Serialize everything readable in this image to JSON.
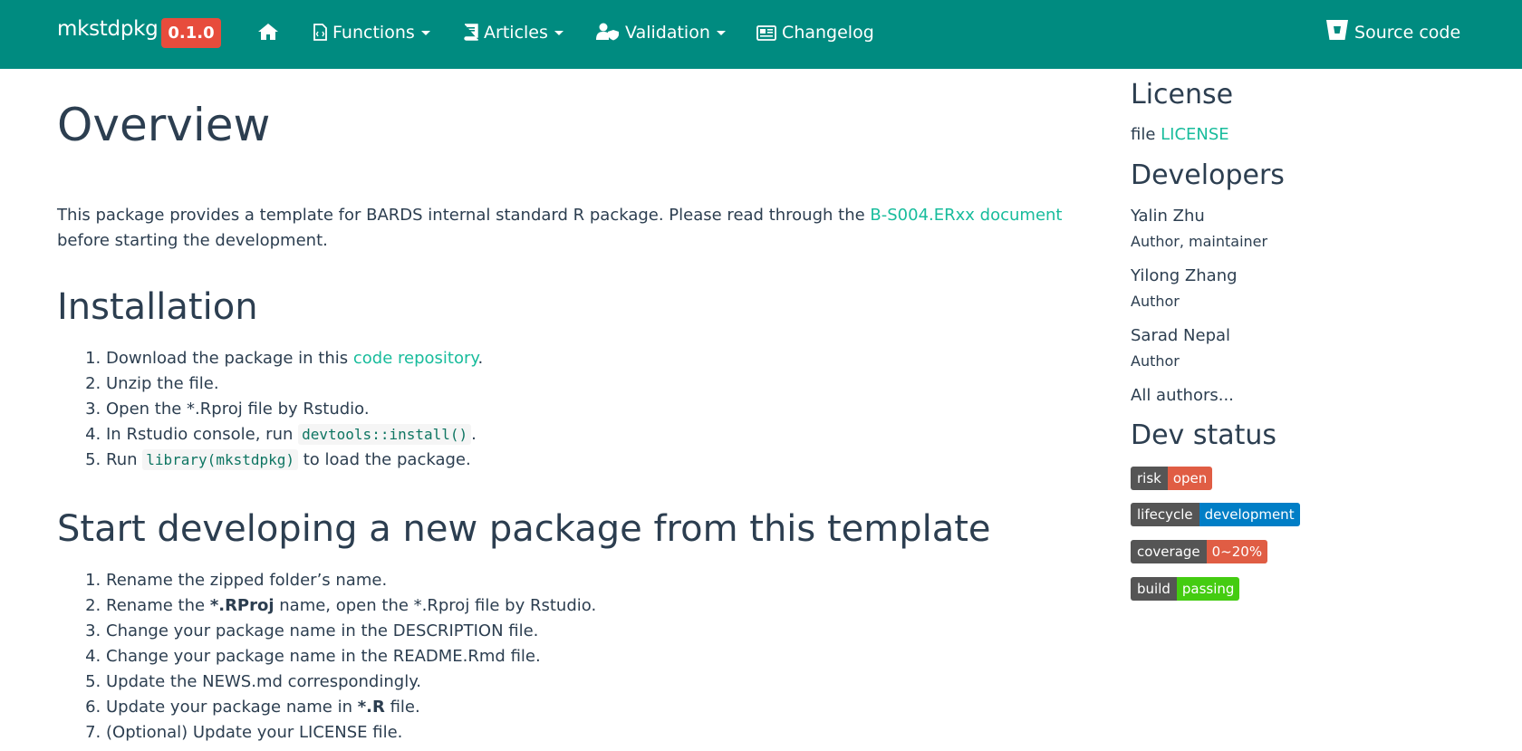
{
  "navbar": {
    "brand": "mkstdpkg",
    "version": "0.1.0",
    "items": {
      "functions": "Functions",
      "articles": "Articles",
      "validation": "Validation",
      "changelog": "Changelog",
      "source": "Source code"
    },
    "icons": [
      "home-icon",
      "file-code-icon",
      "book-icon",
      "user-shield-icon",
      "newspaper-icon",
      "bitbucket-icon"
    ]
  },
  "main": {
    "title": "Overview",
    "intro": {
      "before": "This package provides a template for BARDS internal standard R package. Please read through the ",
      "link": "B-S004.ERxx document",
      "after": " before starting the development."
    },
    "installation": {
      "heading": "Installation",
      "steps": {
        "s1_before": "Download the package in this ",
        "s1_link": "code repository",
        "s1_after": ".",
        "s2": "Unzip the file.",
        "s3": "Open the *.Rproj file by Rstudio.",
        "s4_before": "In Rstudio console, run ",
        "s4_code": "devtools::install()",
        "s4_after": ".",
        "s5_before": "Run ",
        "s5_code": "library(mkstdpkg)",
        "s5_after": " to load the package."
      }
    },
    "start": {
      "heading": "Start developing a new package from this template",
      "steps": {
        "s1": "Rename the zipped folder’s name.",
        "s2_before": "Rename the ",
        "s2_bold": "*.RProj",
        "s2_after": " name, open the *.Rproj file by Rstudio.",
        "s3": "Change your package name in the DESCRIPTION file.",
        "s4": "Change your package name in the README.Rmd file.",
        "s5": "Update the NEWS.md correspondingly.",
        "s6_before": "Update your package name in ",
        "s6_bold": "*.R",
        "s6_after": " file.",
        "s7": "(Optional) Update your LICENSE file."
      }
    }
  },
  "sidebar": {
    "license": {
      "heading": "License",
      "prefix": "file ",
      "link": "LICENSE"
    },
    "developers": {
      "heading": "Developers",
      "people": [
        {
          "name": "Yalin Zhu",
          "role": "Author, maintainer"
        },
        {
          "name": "Yilong Zhang",
          "role": "Author"
        },
        {
          "name": "Sarad Nepal",
          "role": "Author"
        }
      ],
      "all_link": "All authors..."
    },
    "dev_status": {
      "heading": "Dev status",
      "badges": [
        {
          "label": "risk",
          "value": "open",
          "color": "#e05d44"
        },
        {
          "label": "lifecycle",
          "value": "development",
          "color": "#007ec6"
        },
        {
          "label": "coverage",
          "value": "0~20%",
          "color": "#e05d44"
        },
        {
          "label": "build",
          "value": "passing",
          "color": "#4c1"
        }
      ]
    }
  },
  "colors": {
    "navbar_bg": "#008b80",
    "version_badge": "#e74c3c",
    "link": "#18bc9c",
    "text": "#2c3e50"
  }
}
